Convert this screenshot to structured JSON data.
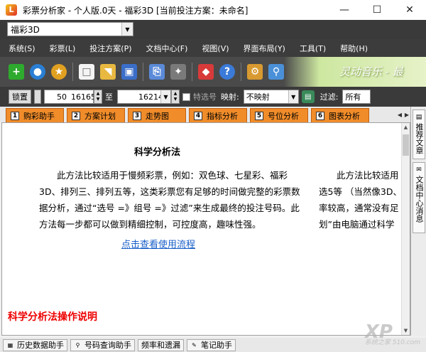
{
  "window": {
    "title": "彩票分析家 - 个人版.0天 - 福彩3D [当前投注方案：未命名]",
    "controls": [
      "minimize-icon",
      "maximize-icon",
      "close-icon"
    ]
  },
  "lottery_select": {
    "value": "福彩3D"
  },
  "menu": [
    "系统(S)",
    "彩票(L)",
    "投注方案(P)",
    "文档中心(F)",
    "视图(V)",
    "界面布局(Y)",
    "工具(T)",
    "帮助(H)"
  ],
  "toolbar": {
    "icons": [
      "add-icon",
      "globe-icon",
      "medal-icon",
      "new-doc-icon",
      "open-folder-icon",
      "save-icon",
      "print-icon",
      "wand-icon",
      "diamond-icon",
      "help-icon",
      "settings-icon",
      "zoom-icon",
      "calculator-icon"
    ],
    "banner_text": "灵动音乐 - 最"
  },
  "filter": {
    "lock_label": "锁置",
    "count_value": "50",
    "from_value": "16165",
    "to_label": "至",
    "to_value": "16214",
    "special_label": "特选号",
    "mapping_label": "映射:",
    "mapping_value": "不映射",
    "filter_label": "过滤:",
    "filter_value": "所有"
  },
  "tabs": [
    {
      "num": "1",
      "label": "购彩助手"
    },
    {
      "num": "2",
      "label": "方案计划"
    },
    {
      "num": "3",
      "label": "走势图"
    },
    {
      "num": "4",
      "label": "指标分析"
    },
    {
      "num": "5",
      "label": "号位分析"
    },
    {
      "num": "6",
      "label": "图表分析"
    }
  ],
  "side_tabs": [
    "推荐文章",
    "文档中心消息"
  ],
  "document": {
    "title": "科学分析法",
    "paragraph": "此方法比较适用于慢频彩票，例如：双色球、七星彩、福彩3D、排列三、排列五等，这类彩票您有足够的时间做完整的彩票数据分析，通过“选号 =》组号 =》过滤”来生成最终的投注号码。此方法每一步都可以做到精细控制，可控度高，趣味性强。",
    "link": "点击查看使用流程",
    "section_heading": "科学分析法操作说明",
    "col2_lines": [
      "此方法比较适用",
      "选5等 （当然像3D、",
      "率较高，通常没有足",
      "划”由电脑通过科学"
    ]
  },
  "bottom_tabs": [
    "历史数据助手",
    "号码查询助手",
    "频率和遗漏",
    "笔记助手"
  ],
  "watermark": {
    "text": "XP",
    "sub": "系统之家 510.com"
  }
}
